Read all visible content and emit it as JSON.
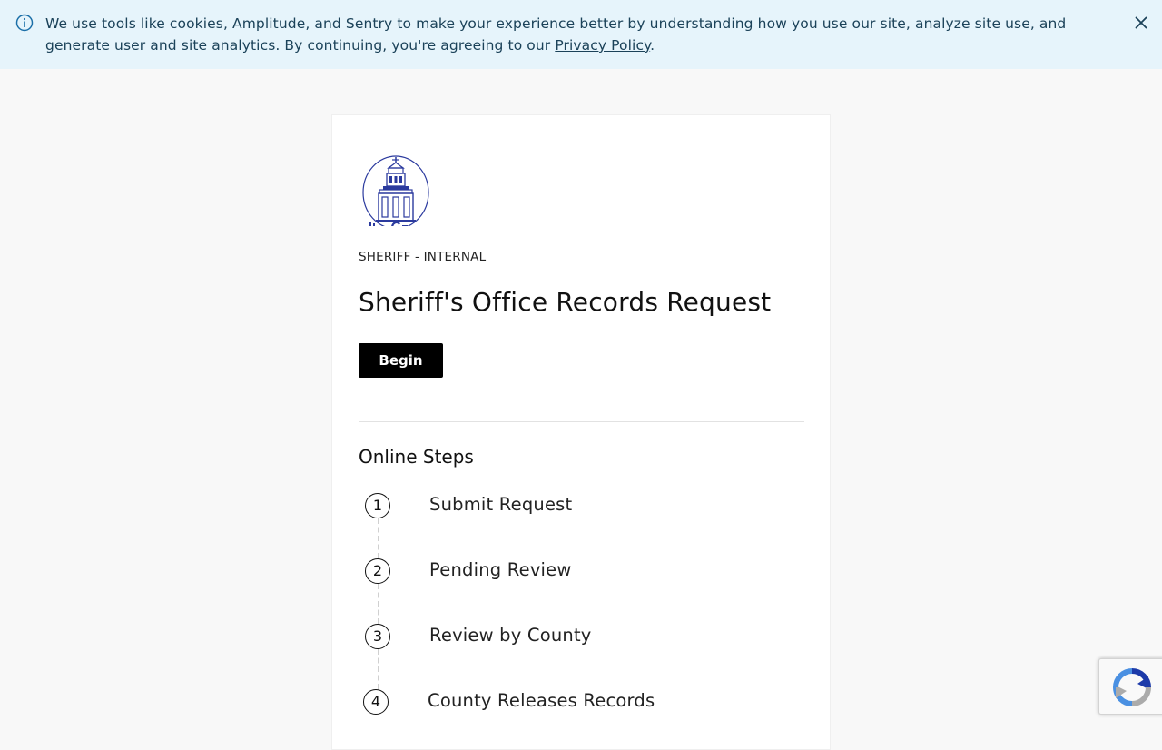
{
  "banner": {
    "text_before_link": "We use tools like cookies, Amplitude, and Sentry to make your experience better by understanding how you use our site, analyze site use, and generate user and site analytics. By continuing, you're agreeing to our ",
    "link_text": "Privacy Policy",
    "text_after_link": ".",
    "icon": "info-icon",
    "close_icon": "close-icon"
  },
  "card": {
    "logo_icon": "county-courthouse-seal",
    "department": "SHERIFF - INTERNAL",
    "title": "Sheriff's Office Records Request",
    "begin_label": "Begin",
    "steps_heading": "Online Steps",
    "steps": [
      {
        "number": "1",
        "label": "Submit Request"
      },
      {
        "number": "2",
        "label": "Pending Review"
      },
      {
        "number": "3",
        "label": "Review by County"
      },
      {
        "number": "4",
        "label": "County Releases Records"
      }
    ]
  },
  "recaptcha": {
    "icon": "recaptcha-icon"
  },
  "colors": {
    "banner_bg": "#e6f4fb",
    "banner_text": "#1b4259",
    "button_bg": "#000000",
    "logo_blue": "#2b3a9e"
  }
}
